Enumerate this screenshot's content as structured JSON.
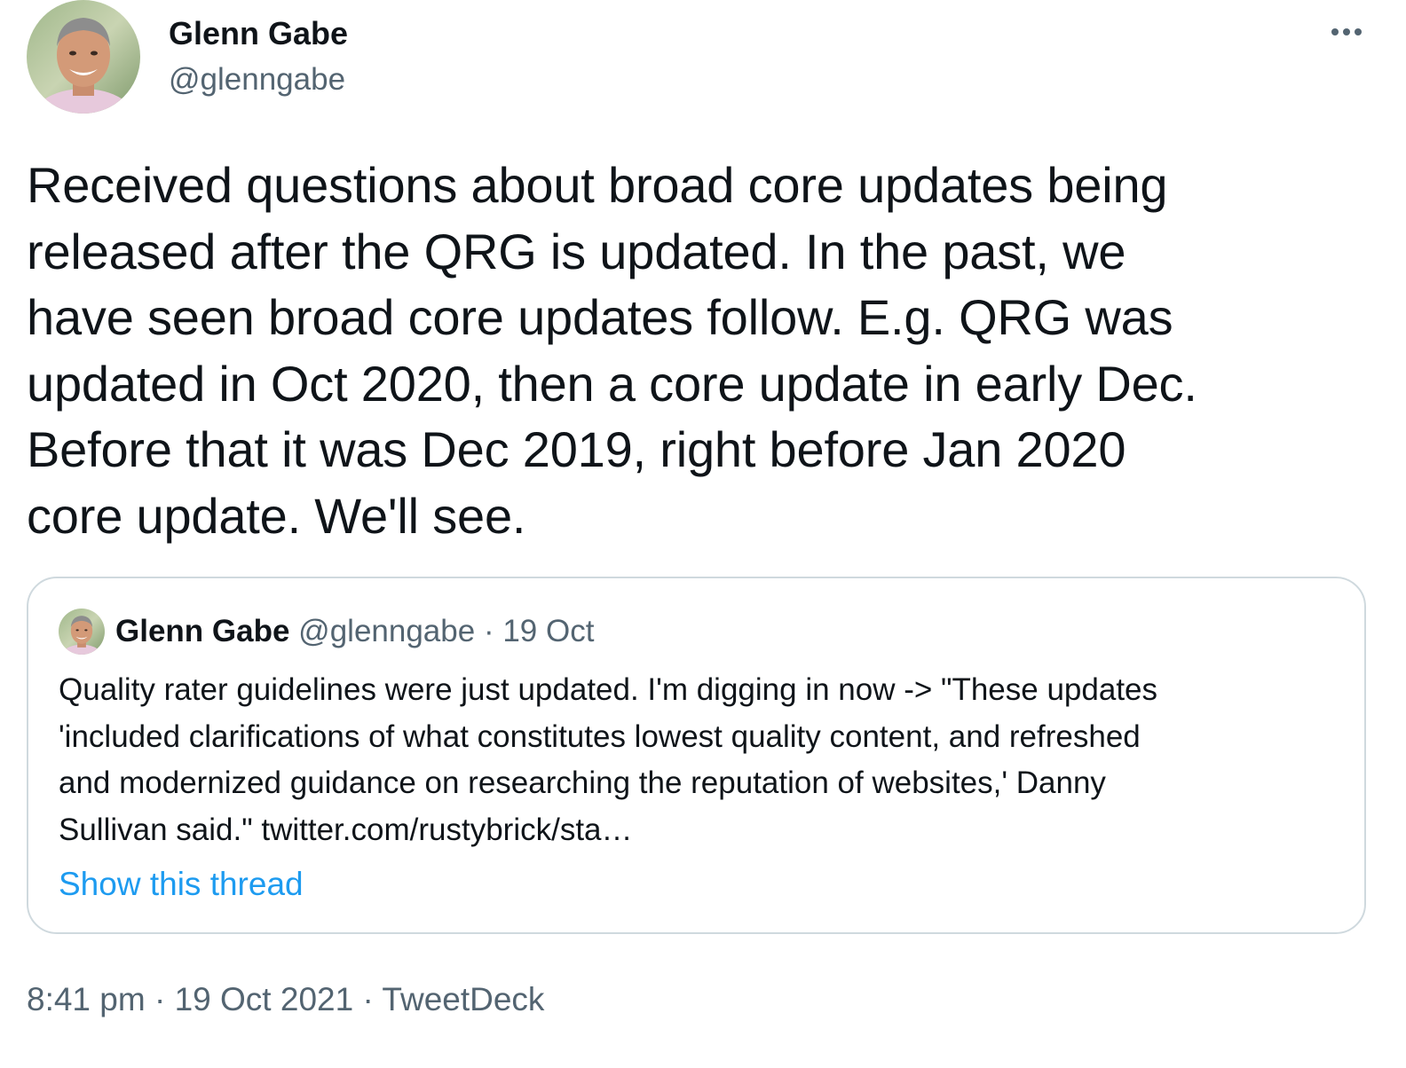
{
  "author": {
    "name": "Glenn Gabe",
    "handle": "@glenngabe"
  },
  "tweet": {
    "text": "Received questions about broad core updates being\nreleased after the QRG is updated. In the past, we\nhave seen broad core updates follow. E.g. QRG was\nupdated in Oct 2020, then a core update in early Dec.\nBefore that it was Dec 2019, right before Jan 2020\ncore update. We'll see."
  },
  "quoted_tweet": {
    "name": "Glenn Gabe",
    "handle": "@glenngabe",
    "separator": "·",
    "date": "19 Oct",
    "text": "Quality rater guidelines were just updated. I'm digging in now -> \"These updates\n'included clarifications of what constitutes lowest quality content, and refreshed\nand modernized guidance on researching the reputation of websites,' Danny\nSullivan said.\" twitter.com/rustybrick/sta…",
    "show_thread_label": "Show this thread"
  },
  "meta": {
    "time": "8:41 pm",
    "separator_1": "·",
    "date": "19 Oct 2021",
    "separator_2": "·",
    "source": "TweetDeck"
  },
  "icons": {
    "more": "more-horizontal-icon"
  },
  "colors": {
    "text_primary": "#0f1419",
    "text_secondary": "#536471",
    "link": "#1d9bf0",
    "border": "#cfd9de"
  }
}
